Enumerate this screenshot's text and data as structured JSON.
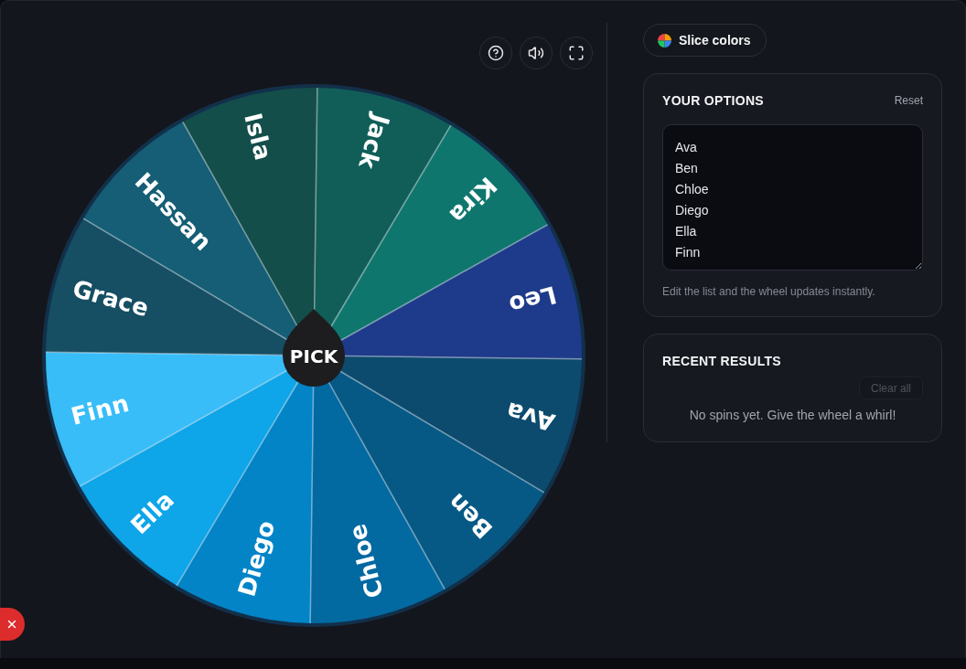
{
  "wheel": {
    "slices": [
      {
        "label": "Ava",
        "color": "#0c4a6e"
      },
      {
        "label": "Ben",
        "color": "#075985"
      },
      {
        "label": "Chloe",
        "color": "#0369a1"
      },
      {
        "label": "Diego",
        "color": "#0284c7"
      },
      {
        "label": "Ella",
        "color": "#0ea5e9"
      },
      {
        "label": "Finn",
        "color": "#38bdf8"
      },
      {
        "label": "Grace",
        "color": "#164e63"
      },
      {
        "label": "Hassan",
        "color": "#155e75"
      },
      {
        "label": "Isla",
        "color": "#134e4a"
      },
      {
        "label": "Jack",
        "color": "#115e59"
      },
      {
        "label": "Kira",
        "color": "#0f766e"
      },
      {
        "label": "Leo",
        "color": "#1e3a8a"
      }
    ],
    "center_button": "PICK"
  },
  "slice_colors_button": "Slice colors",
  "options_panel": {
    "title": "YOUR OPTIONS",
    "reset": "Reset",
    "lines": [
      "Ava",
      "Ben",
      "Chloe",
      "Diego",
      "Ella",
      "Finn"
    ],
    "hint": "Edit the list and the wheel updates instantly."
  },
  "results_panel": {
    "title": "RECENT RESULTS",
    "clear_button": {
      "label": "Clear all",
      "disabled": true
    },
    "empty_message": "No spins yet. Give the wheel a whirl!"
  }
}
